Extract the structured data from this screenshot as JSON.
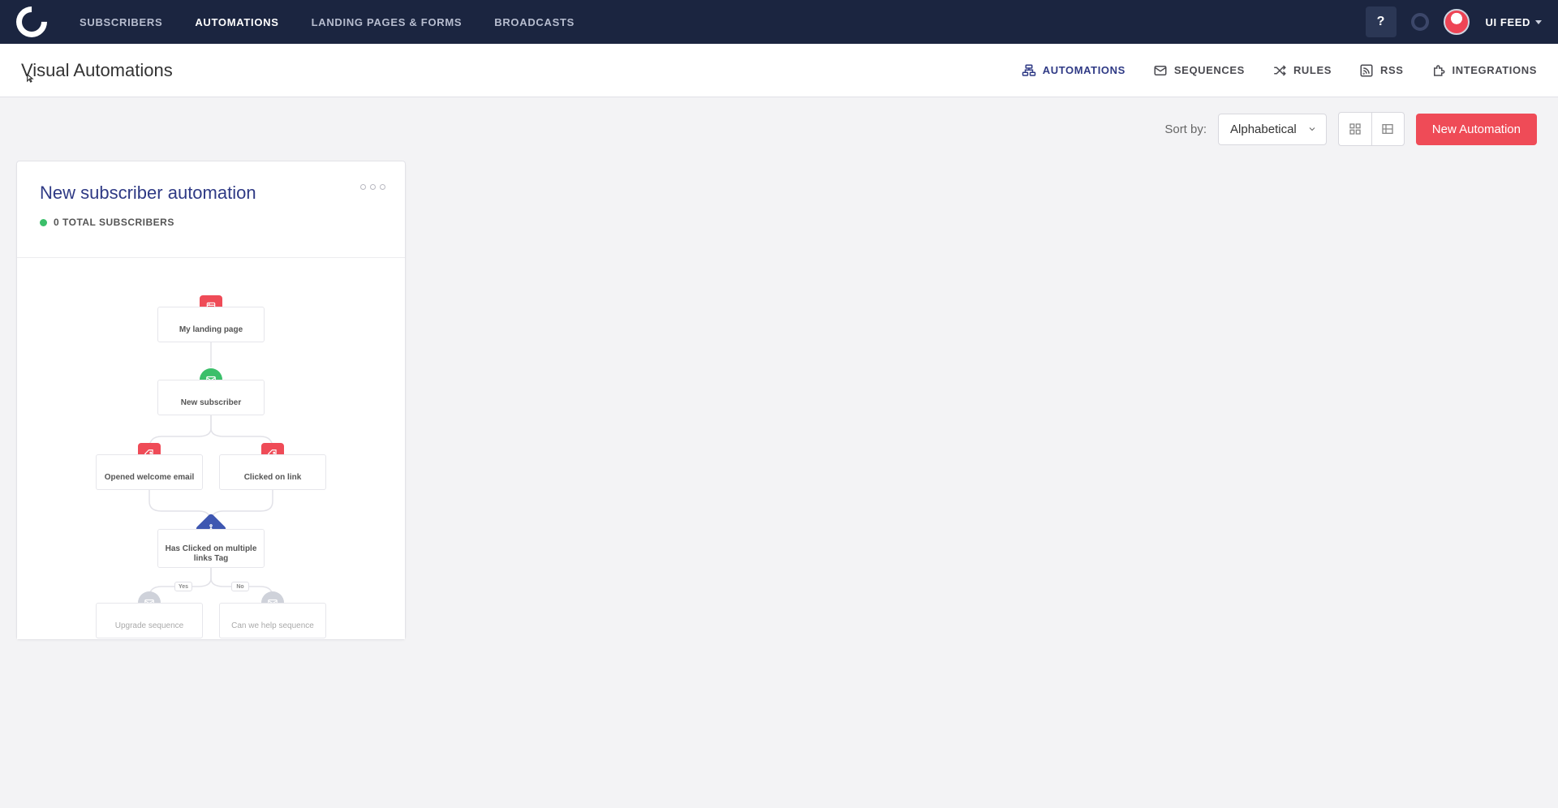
{
  "top_nav": {
    "items": [
      {
        "label": "SUBSCRIBERS"
      },
      {
        "label": "AUTOMATIONS"
      },
      {
        "label": "LANDING PAGES & FORMS"
      },
      {
        "label": "BROADCASTS"
      }
    ],
    "help": "?",
    "user": "UI FEED"
  },
  "sub_header": {
    "title": "Visual Automations",
    "tabs": [
      {
        "label": "AUTOMATIONS"
      },
      {
        "label": "SEQUENCES"
      },
      {
        "label": "RULES"
      },
      {
        "label": "RSS"
      },
      {
        "label": "INTEGRATIONS"
      }
    ]
  },
  "toolbar": {
    "sort_label": "Sort by:",
    "sort_value": "Alphabetical",
    "new_automation": "New Automation"
  },
  "card": {
    "title": "New subscriber automation",
    "subscriber_line": "0 TOTAL SUBSCRIBERS",
    "nodes": {
      "landing": "My landing page",
      "new_sub": "New subscriber",
      "opened": "Opened welcome email",
      "clicked": "Clicked on link",
      "condition": "Has Clicked on multiple links Tag",
      "yes": "Yes",
      "no": "No",
      "upgrade": "Upgrade sequence",
      "help": "Can we help sequence"
    }
  }
}
